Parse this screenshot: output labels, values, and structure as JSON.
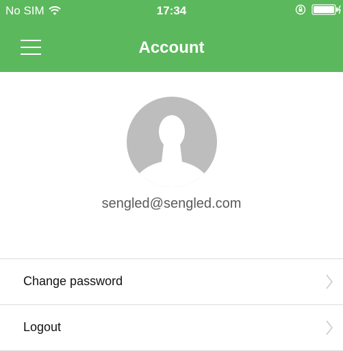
{
  "status_bar": {
    "carrier": "No SIM",
    "time": "17:34",
    "icons": [
      "wifi-icon",
      "orientation-lock-icon",
      "battery-icon"
    ]
  },
  "nav": {
    "title": "Account",
    "menu_icon": "menu-icon"
  },
  "profile": {
    "avatar_icon": "user-avatar-icon",
    "email": "sengled@sengled.com"
  },
  "menu_items": [
    {
      "label": "Change password",
      "icon": "chevron-right-icon"
    },
    {
      "label": "Logout",
      "icon": "chevron-right-icon"
    }
  ],
  "colors": {
    "header": "#5cb85c",
    "header_text": "#ffffff",
    "divider": "#dcdcdc",
    "avatar_bg": "#bdbdbd",
    "battery": "#4cd964"
  }
}
